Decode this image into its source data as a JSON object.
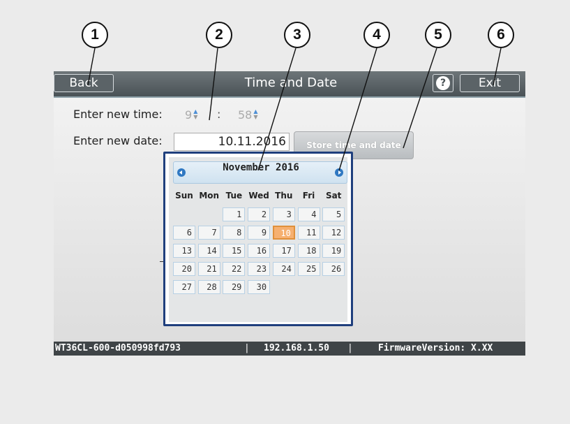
{
  "callouts": [
    "1",
    "2",
    "3",
    "4",
    "5",
    "6"
  ],
  "header": {
    "back_label": "Back",
    "title": "Time and Date",
    "help_icon": "?",
    "exit_label": "Exit"
  },
  "form": {
    "time_label": "Enter new time:",
    "hour_value": "9",
    "time_separator": ":",
    "minute_value": "58",
    "date_label": "Enter new date:",
    "date_value": "10.11.2016",
    "store_button": "Store time and date"
  },
  "calendar": {
    "month_year": "November 2016",
    "weekdays": [
      "Sun",
      "Mon",
      "Tue",
      "Wed",
      "Thu",
      "Fri",
      "Sat"
    ],
    "selected_day": "10",
    "days": [
      "1",
      "2",
      "3",
      "4",
      "5",
      "6",
      "7",
      "8",
      "9",
      "10",
      "11",
      "12",
      "13",
      "14",
      "15",
      "16",
      "17",
      "18",
      "19",
      "20",
      "21",
      "22",
      "23",
      "24",
      "25",
      "26",
      "27",
      "28",
      "29",
      "30"
    ],
    "first_weekday_index": 2
  },
  "statusbar": {
    "device_name": "WT36CL-600-d050998fd793",
    "separator": "|",
    "ip_address": "192.168.1.50",
    "firmware": "FirmwareVersion: X.XX"
  },
  "colors": {
    "header_bg": "#4a5256",
    "calendar_border": "#1f3f7d",
    "selected_day": "#f6b070",
    "nav_icon": "#2f78c2"
  }
}
